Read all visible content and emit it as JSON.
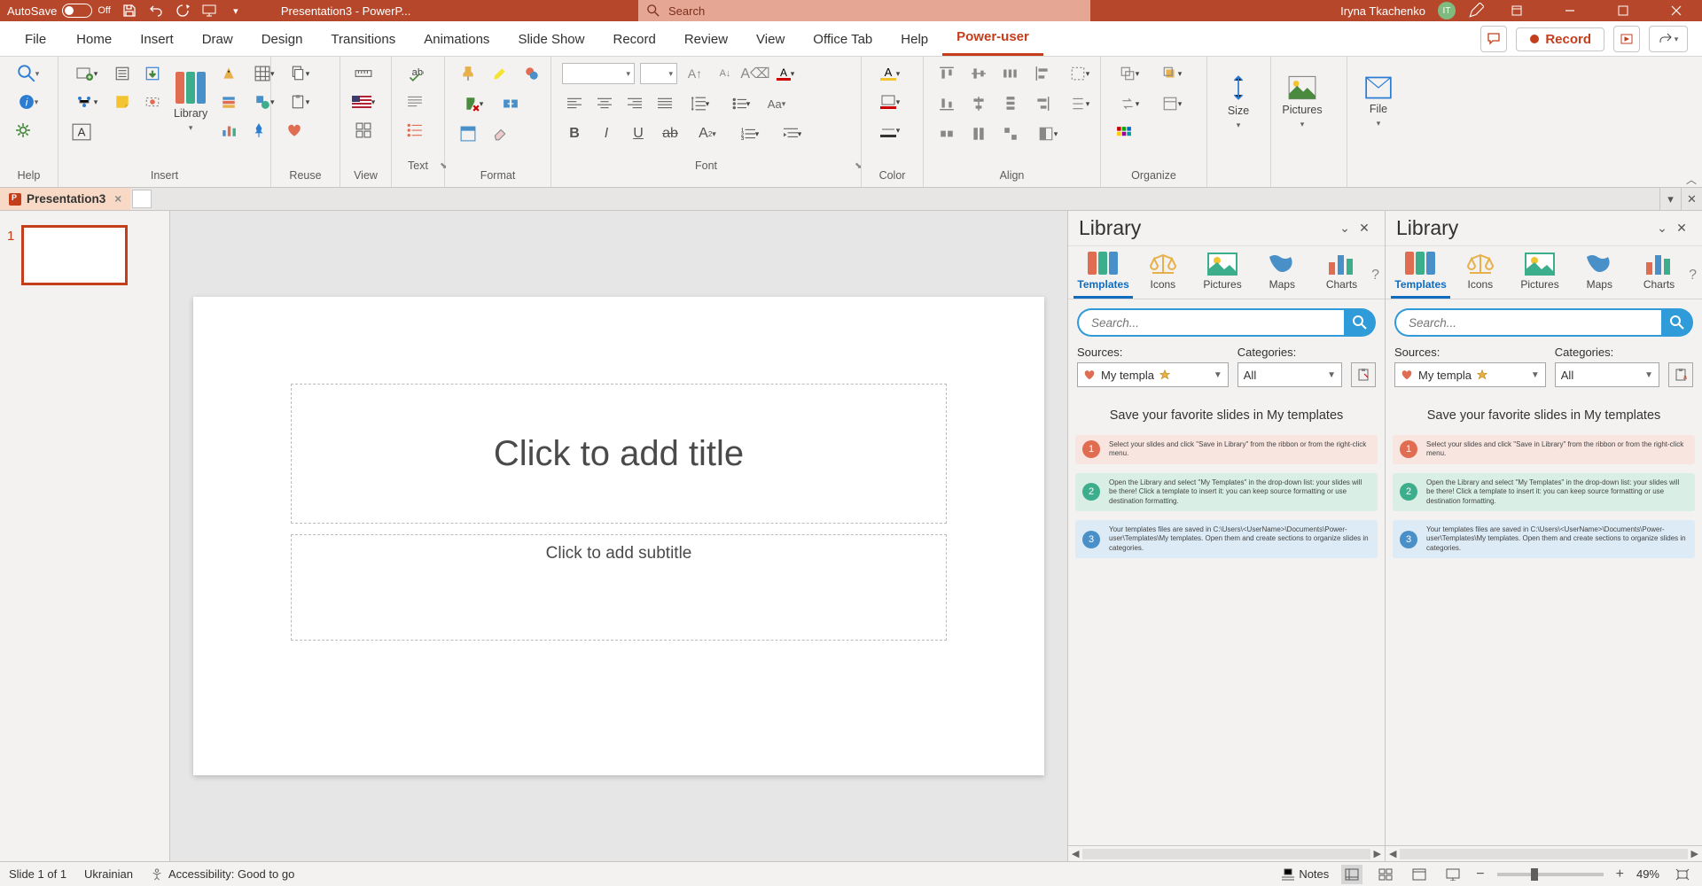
{
  "titlebar": {
    "autosave_label": "AutoSave",
    "autosave_state": "Off",
    "doc_title": "Presentation3  -  PowerP...",
    "search_placeholder": "Search",
    "user_name": "Iryna Tkachenko",
    "user_initials": "IT"
  },
  "ribbon_tabs": [
    "File",
    "Home",
    "Insert",
    "Draw",
    "Design",
    "Transitions",
    "Animations",
    "Slide Show",
    "Record",
    "Review",
    "View",
    "Office Tab",
    "Help",
    "Power-user"
  ],
  "ribbon_active_tab": "Power-user",
  "record_button": "Record",
  "ribbon_groups": {
    "help": "Help",
    "insert": "Insert",
    "library_btn": "Library",
    "reuse": "Reuse",
    "view": "View",
    "text": "Text",
    "format": "Format",
    "font": "Font",
    "color": "Color",
    "align": "Align",
    "organize": "Organize",
    "size": "Size",
    "pictures": "Pictures",
    "file_g": "File"
  },
  "doc_tab": {
    "name": "Presentation3",
    "close": "×"
  },
  "thumbnails": {
    "slide1_number": "1"
  },
  "slide": {
    "title_placeholder": "Click to add title",
    "subtitle_placeholder": "Click to add subtitle"
  },
  "library_pane": {
    "title": "Library",
    "tabs": [
      "Templates",
      "Icons",
      "Pictures",
      "Maps",
      "Charts"
    ],
    "active_tab": "Templates",
    "search_placeholder": "Search...",
    "sources_label": "Sources:",
    "sources_value": "My templa",
    "categories_label": "Categories:",
    "categories_value": "All",
    "hint_title": "Save your favorite slides in My templates",
    "steps": [
      {
        "n": "1",
        "t": "Select your slides and click \"Save in Library\" from the ribbon or from the right-click menu."
      },
      {
        "n": "2",
        "t": "Open the Library and select \"My Templates\" in the drop-down list: your slides will be there! Click a template to insert it: you can keep source formatting or use destination formatting."
      },
      {
        "n": "3",
        "t": "Your templates files are saved in C:\\Users\\<UserName>\\Documents\\Power-user\\Templates\\My templates. Open them and create sections to organize slides in categories."
      }
    ]
  },
  "status": {
    "slide_info": "Slide 1 of 1",
    "language": "Ukrainian",
    "accessibility": "Accessibility: Good to go",
    "notes": "Notes",
    "zoom": "49%"
  }
}
